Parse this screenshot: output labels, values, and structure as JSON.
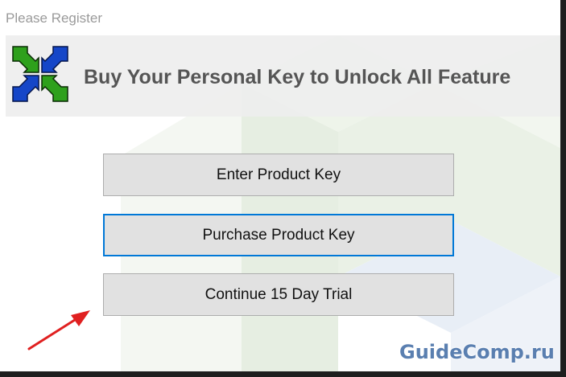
{
  "window": {
    "title": "Please Register"
  },
  "header": {
    "text": "Buy Your Personal Key to Unlock All Feature"
  },
  "buttons": {
    "enter_key": "Enter Product Key",
    "purchase_key": "Purchase Product Key",
    "continue_trial": "Continue 15 Day Trial"
  },
  "watermark": {
    "text": "GuideComp.ru"
  },
  "colors": {
    "accent_focus": "#0078d7",
    "logo_green": "#2ea01c",
    "logo_blue": "#1546c8",
    "arrow_red": "#e02020"
  }
}
